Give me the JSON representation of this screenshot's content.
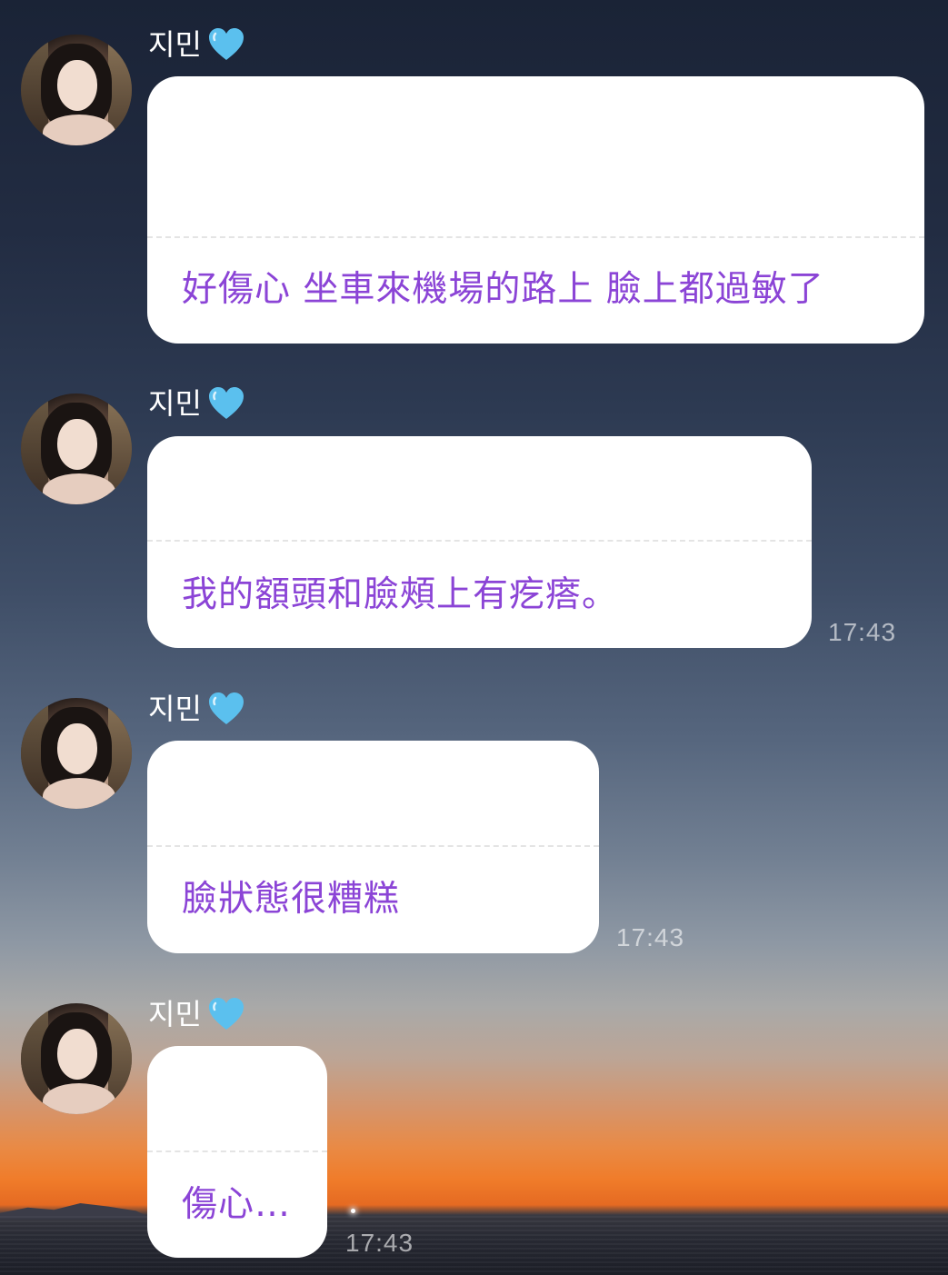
{
  "chat": {
    "messages": [
      {
        "sender": "지민",
        "text": "好傷心 坐車來機場的路上 臉上都過敏了",
        "time": ""
      },
      {
        "sender": "지민",
        "text": "我的額頭和臉頰上有疙瘩。",
        "time": "17:43"
      },
      {
        "sender": "지민",
        "text": "臉狀態很糟糕",
        "time": "17:43"
      },
      {
        "sender": "지민",
        "text": "傷心…",
        "time": "17:43"
      }
    ]
  },
  "colors": {
    "message_text": "#8b44d6",
    "heart": "#5bc0ee",
    "bubble": "#ffffff"
  },
  "icons": {
    "sender_badge": "blue-heart-icon"
  }
}
